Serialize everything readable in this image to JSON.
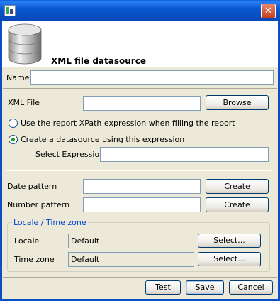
{
  "window": {
    "title": "",
    "close_label": "✕"
  },
  "header": {
    "title": "XML file datasource"
  },
  "form": {
    "name_label": "Name",
    "name_value": "",
    "xml_file_label": "XML File",
    "xml_file_value": "",
    "browse_label": "Browse",
    "radio_xpath_label": "Use the report XPath expression when filling the report",
    "radio_create_label": "Create a datasource using this expression",
    "select_expression_label": "Select Expression",
    "select_expression_value": "",
    "date_pattern_label": "Date pattern",
    "date_pattern_value": "",
    "date_create_label": "Create",
    "number_pattern_label": "Number pattern",
    "number_pattern_value": "",
    "number_create_label": "Create",
    "selected_radio": "create"
  },
  "locale_group": {
    "legend": "Locale / Time zone",
    "locale_label": "Locale",
    "locale_value": "Default",
    "locale_select_label": "Select...",
    "timezone_label": "Time zone",
    "timezone_value": "Default",
    "timezone_select_label": "Select..."
  },
  "buttons": {
    "test": "Test",
    "save": "Save",
    "cancel": "Cancel"
  },
  "colors": {
    "titlebar": "#0a5fd8",
    "legend_text": "#0046d5",
    "dialog_bg": "#ece9d8"
  },
  "icons": {
    "title": "app-icon",
    "header": "database-icon"
  }
}
